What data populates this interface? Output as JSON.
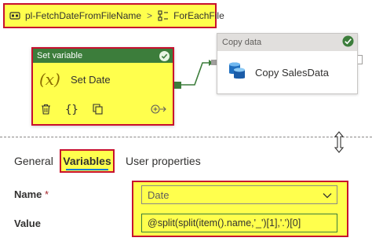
{
  "breadcrumb": {
    "pipeline": "pl-FetchDateFromFileName",
    "separator": ">",
    "activity": "ForEachFile"
  },
  "set_variable_activity": {
    "type_label": "Set variable",
    "name": "Set Date",
    "icon": "fx-icon",
    "status_icon": "check-circle-icon",
    "toolbar_icons": [
      "delete-icon",
      "code-icon",
      "copy-icon",
      "add-output-icon"
    ]
  },
  "copy_activity": {
    "type_label": "Copy data",
    "name": "Copy SalesData",
    "icon": "database-icon",
    "status_icon": "check-circle-icon"
  },
  "tabs": {
    "general": "General",
    "variables": "Variables",
    "user_properties": "User properties",
    "active": "Variables"
  },
  "properties": {
    "name_label": "Name",
    "required_marker": "*",
    "name_value": "Date",
    "value_label": "Value",
    "value_text": "@split(split(item().name,'_')[1],'.')[0]"
  },
  "colors": {
    "highlight_yellow": "#ffff4d",
    "highlight_border": "#c8102e",
    "activity_green": "#3c7d3b",
    "accent_blue": "#0078d4"
  }
}
